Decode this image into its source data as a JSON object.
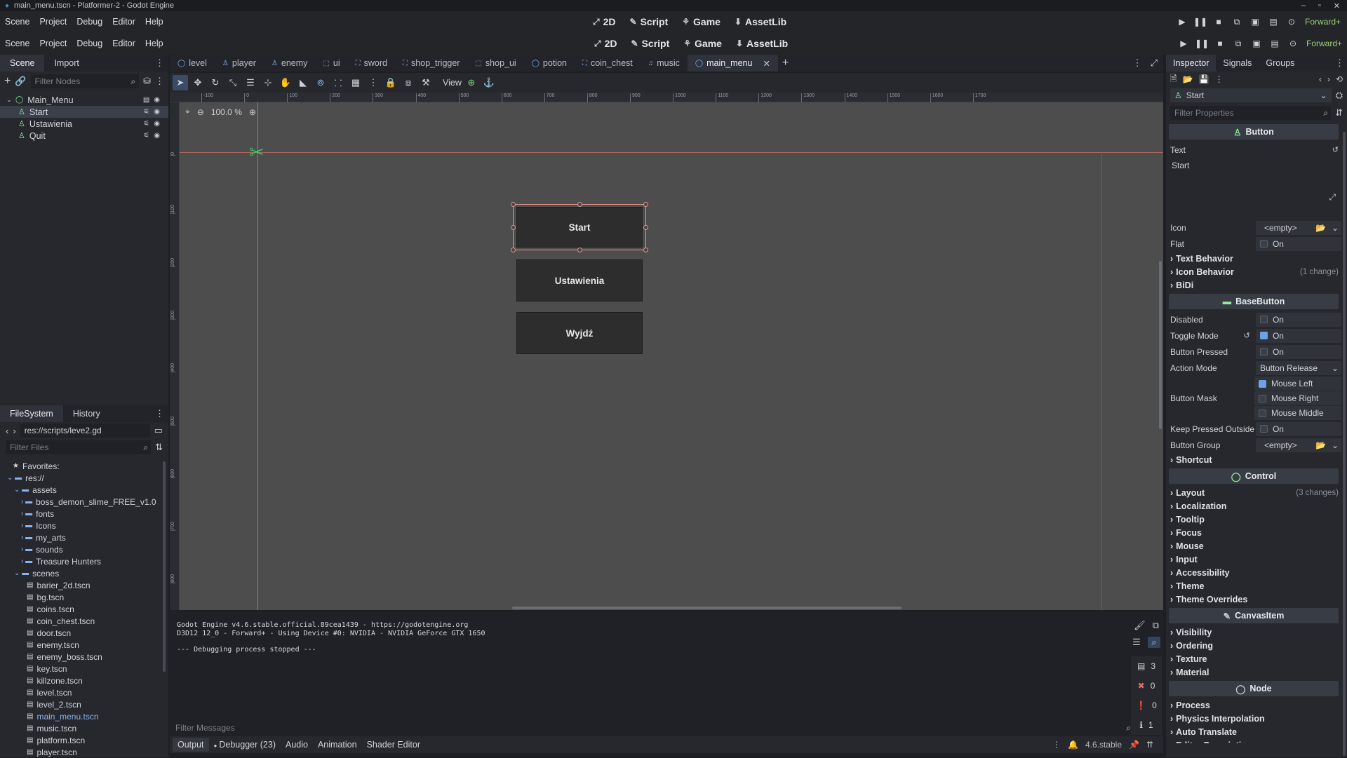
{
  "window": {
    "title": "main_menu.tscn - Platformer-2 - Godot Engine"
  },
  "os_menu": {
    "items": [
      "Scene",
      "Project",
      "Debug",
      "Editor",
      "Help"
    ],
    "workspaces": [
      "2D",
      "Script",
      "Game",
      "AssetLib"
    ],
    "renderer": "Forward+"
  },
  "main_menu": {
    "items": [
      "Scene",
      "Project",
      "Debug",
      "Editor",
      "Help"
    ],
    "workspaces": [
      "2D",
      "Script",
      "Game",
      "AssetLib"
    ],
    "renderer": "Forward+"
  },
  "scene_dock": {
    "tabs": [
      "Scene",
      "Import"
    ],
    "filter_placeholder": "Filter Nodes",
    "nodes": [
      {
        "name": "Main_Menu",
        "root": true
      },
      {
        "name": "Start",
        "selected": true
      },
      {
        "name": "Ustawienia"
      },
      {
        "name": "Quit"
      }
    ]
  },
  "filesystem_dock": {
    "tabs": [
      "FileSystem",
      "History"
    ],
    "path": "res://scripts/leve2.gd",
    "filter_placeholder": "Filter Files",
    "favorites": "Favorites:",
    "root": "res://",
    "folders_assets": "assets",
    "asset_children": [
      "boss_demon_slime_FREE_v1.0",
      "fonts",
      "Icons",
      "my_arts",
      "sounds",
      "Treasure Hunters"
    ],
    "scenes_folder": "scenes",
    "scene_files": [
      "barier_2d.tscn",
      "bg.tscn",
      "coins.tscn",
      "coin_chest.tscn",
      "door.tscn",
      "enemy.tscn",
      "enemy_boss.tscn",
      "key.tscn",
      "killzone.tscn",
      "level.tscn",
      "level_2.tscn",
      "main_menu.tscn",
      "music.tscn",
      "platform.tscn",
      "player.tscn"
    ]
  },
  "scene_tabs": [
    "level",
    "player",
    "enemy",
    "ui",
    "sword",
    "shop_trigger",
    "shop_ui",
    "potion",
    "coin_chest",
    "music",
    "main_menu"
  ],
  "toolbar": {
    "view_label": "View",
    "zoom": "100.0 %"
  },
  "ruler_top": [
    "-100",
    "0",
    "100",
    "200",
    "300",
    "400",
    "500",
    "600",
    "700",
    "800",
    "900",
    "1000",
    "1100",
    "1200",
    "1300",
    "1400",
    "1500",
    "1600",
    "1700"
  ],
  "ruler_left": [
    "0",
    "100",
    "200",
    "300",
    "400",
    "500",
    "600",
    "700",
    "800"
  ],
  "canvas_buttons": [
    "Start",
    "Ustawienia",
    "Wyjdź"
  ],
  "output": {
    "lines": [
      "Godot Engine v4.6.stable.official.89cea1439 - https://godotengine.org",
      "D3D12 12_0 - Forward+ - Using Device #0: NVIDIA - NVIDIA GeForce GTX 1650",
      "",
      "--- Debugging process stopped ---"
    ],
    "filter_placeholder": "Filter Messages",
    "counts": [
      "3",
      "0",
      "0",
      "1"
    ]
  },
  "bottom_tabs": [
    "Output",
    "Debugger (23)",
    "Audio",
    "Animation",
    "Shader Editor"
  ],
  "version": "4.6.stable",
  "inspector": {
    "tabs": [
      "Inspector",
      "Signals",
      "Groups"
    ],
    "node": "Start",
    "filter_placeholder": "Filter Properties",
    "cat_button": "Button",
    "text_label": "Text",
    "text_value": "Start",
    "icon_label": "Icon",
    "icon_value": "<empty>",
    "flat_label": "Flat",
    "on": "On",
    "sec_text_behavior": "Text Behavior",
    "sec_icon_behavior": "Icon Behavior",
    "icon_behavior_changes": "(1 change)",
    "sec_bidi": "BiDi",
    "cat_basebutton": "BaseButton",
    "disabled_label": "Disabled",
    "toggle_label": "Toggle Mode",
    "pressed_label": "Button Pressed",
    "action_label": "Action Mode",
    "action_value": "Button Release",
    "mask_label": "Button Mask",
    "mask_options": [
      "Mouse Left",
      "Mouse Right",
      "Mouse Middle"
    ],
    "keep_label": "Keep Pressed Outside",
    "group_label": "Button Group",
    "group_value": "<empty>",
    "sec_shortcut": "Shortcut",
    "cat_control": "Control",
    "control_sections": [
      "Layout",
      "Localization",
      "Tooltip",
      "Focus",
      "Mouse",
      "Input",
      "Accessibility",
      "Theme",
      "Theme Overrides"
    ],
    "layout_changes": "(3 changes)",
    "cat_canvasitem": "CanvasItem",
    "canvas_sections": [
      "Visibility",
      "Ordering",
      "Texture",
      "Material"
    ],
    "cat_node": "Node",
    "node_sections": [
      "Process",
      "Physics Interpolation",
      "Auto Translate",
      "Editor Description"
    ]
  },
  "colors": {
    "accent": "#6ea1e8",
    "selection_border": "#e59487",
    "guide_green": "#3fbf6a",
    "canvas_bg": "#4d4d4d"
  }
}
